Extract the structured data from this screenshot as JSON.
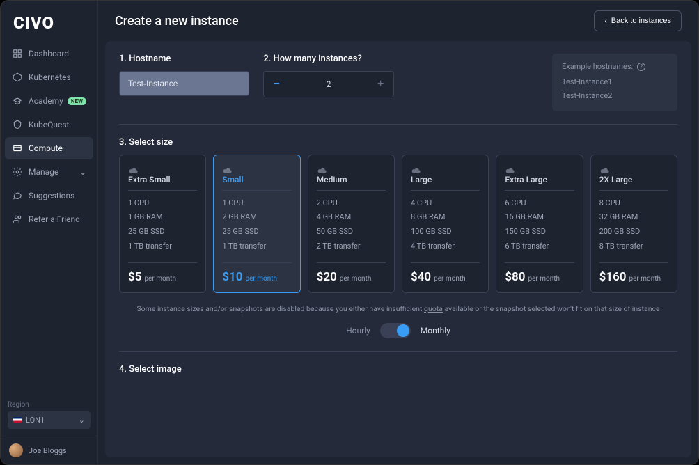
{
  "logo": "CIVO",
  "sidebar": {
    "items": [
      {
        "label": "Dashboard",
        "icon": "dashboard",
        "badge": null
      },
      {
        "label": "Kubernetes",
        "icon": "kube",
        "badge": null
      },
      {
        "label": "Academy",
        "icon": "academy",
        "badge": "NEW"
      },
      {
        "label": "KubeQuest",
        "icon": "shield",
        "badge": null
      },
      {
        "label": "Compute",
        "icon": "compute",
        "badge": null,
        "active": true
      },
      {
        "label": "Manage",
        "icon": "gear",
        "badge": null,
        "chevron": true
      },
      {
        "label": "Suggestions",
        "icon": "chat",
        "badge": null
      },
      {
        "label": "Refer a Friend",
        "icon": "users",
        "badge": null
      }
    ]
  },
  "region": {
    "label": "Region",
    "value": "LON1"
  },
  "user": {
    "name": "Joe Bloggs"
  },
  "header": {
    "title": "Create a new instance",
    "back_label": "Back to instances"
  },
  "form": {
    "hostname": {
      "label": "1. Hostname",
      "value": "Test-Instance"
    },
    "quantity": {
      "label": "2. How many instances?",
      "value": "2"
    },
    "example": {
      "title": "Example hostnames:",
      "items": [
        "Test-Instance1",
        "Test-Instance2"
      ]
    },
    "size_label": "3. Select size",
    "sizes": [
      {
        "name": "Extra Small",
        "cpu": "1 CPU",
        "ram": "1 GB RAM",
        "ssd": "25 GB SSD",
        "transfer": "1 TB transfer",
        "price": "$5",
        "unit": "per month",
        "selected": false
      },
      {
        "name": "Small",
        "cpu": "1 CPU",
        "ram": "2 GB RAM",
        "ssd": "25 GB SSD",
        "transfer": "1 TB transfer",
        "price": "$10",
        "unit": "per month",
        "selected": true
      },
      {
        "name": "Medium",
        "cpu": "2 CPU",
        "ram": "4 GB RAM",
        "ssd": "50 GB SSD",
        "transfer": "2 TB transfer",
        "price": "$20",
        "unit": "per month",
        "selected": false
      },
      {
        "name": "Large",
        "cpu": "4 CPU",
        "ram": "8 GB RAM",
        "ssd": "100 GB SSD",
        "transfer": "4 TB transfer",
        "price": "$40",
        "unit": "per month",
        "selected": false
      },
      {
        "name": "Extra Large",
        "cpu": "6 CPU",
        "ram": "16 GB RAM",
        "ssd": "150 GB SSD",
        "transfer": "6 TB transfer",
        "price": "$80",
        "unit": "per month",
        "selected": false
      },
      {
        "name": "2X Large",
        "cpu": "8 CPU",
        "ram": "32 GB RAM",
        "ssd": "200 GB SSD",
        "transfer": "8 TB transfer",
        "price": "$160",
        "unit": "per month",
        "selected": false
      }
    ],
    "note_pre": "Some instance sizes and/or snapshots are disabled because you either have insufficient ",
    "note_link": "quota",
    "note_post": " available or the snapshot selected won't fit on that size of instance",
    "billing": {
      "left": "Hourly",
      "right": "Monthly"
    },
    "image_label": "4. Select image"
  }
}
